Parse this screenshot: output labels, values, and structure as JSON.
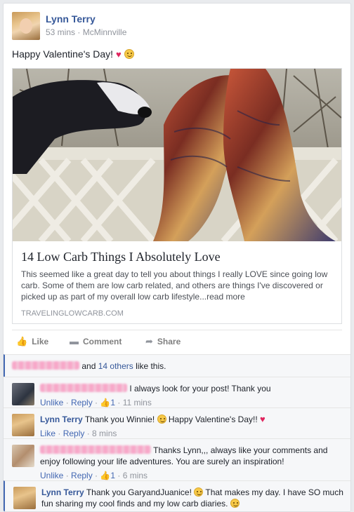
{
  "post": {
    "author": "Lynn Terry",
    "time": "53 mins",
    "separator": "·",
    "location": "McMinnville",
    "text": "Happy Valentine's Day!",
    "heart": "♥"
  },
  "link": {
    "title": "14 Low Carb Things I Absolutely Love",
    "description": "This seemed like a great day to tell you about things I really LOVE since going low carb. Some of them are low carb related, and others are things I've discovered or picked up as part of my overall low carb lifestyle...read more",
    "domain": "TRAVELINGLOWCARB.COM"
  },
  "actions": {
    "like": "Like",
    "comment": "Comment",
    "share": "Share"
  },
  "likes": {
    "and": "and",
    "others": "14 others",
    "suffix": "like this."
  },
  "comments": [
    {
      "text": "I always look for your post! Thank you",
      "unlike": "Unlike",
      "reply": "Reply",
      "like_count": "1",
      "time": "11 mins"
    },
    {
      "name": "Lynn Terry",
      "text": "Thank you Winnie!",
      "text2": "Happy Valentine's Day!!",
      "like": "Like",
      "reply": "Reply",
      "time": "8 mins"
    },
    {
      "text": "Thanks Lynn,,, always like your comments and enjoy following your life adventures. You are surely an inspiration!",
      "unlike": "Unlike",
      "reply": "Reply",
      "like_count": "1",
      "time": "6 mins"
    },
    {
      "name": "Lynn Terry",
      "text": "Thank you GaryandJuanice!",
      "text2": "That makes my day. I have SO much fun sharing my cool finds and my low carb diaries."
    }
  ],
  "colors": {
    "link": "#365899",
    "meta": "#90949c",
    "heart": "#e0245e",
    "accent": "#4267b2"
  }
}
